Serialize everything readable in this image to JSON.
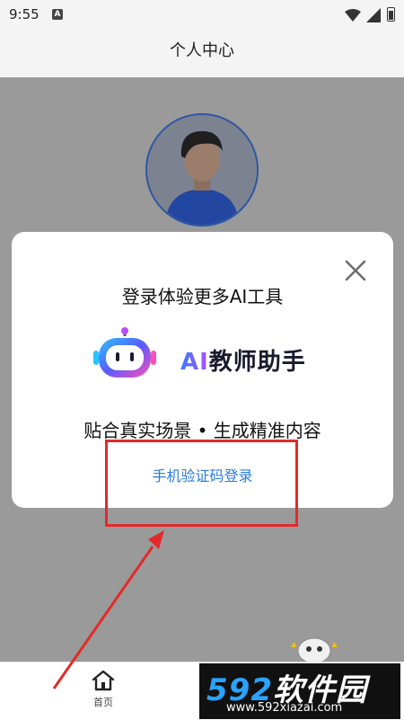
{
  "status_bar": {
    "time": "9:55",
    "notification_badge": "A"
  },
  "header": {
    "title": "个人中心"
  },
  "dialog": {
    "title": "登录体验更多AI工具",
    "brand": {
      "ai": "AI",
      "name": "教师助手"
    },
    "slogan": "贴合真实场景 • 生成精准内容",
    "phone_login_label": "手机验证码登录"
  },
  "bottom_nav": {
    "home_label": "首页"
  },
  "watermark": {
    "logo_num": "592",
    "logo_text": "软件园",
    "url": "www.592xiazai.com"
  },
  "colors": {
    "accent": "#2a7be0",
    "highlight": "#e32a2a",
    "overlay": "#9a9a9a"
  }
}
